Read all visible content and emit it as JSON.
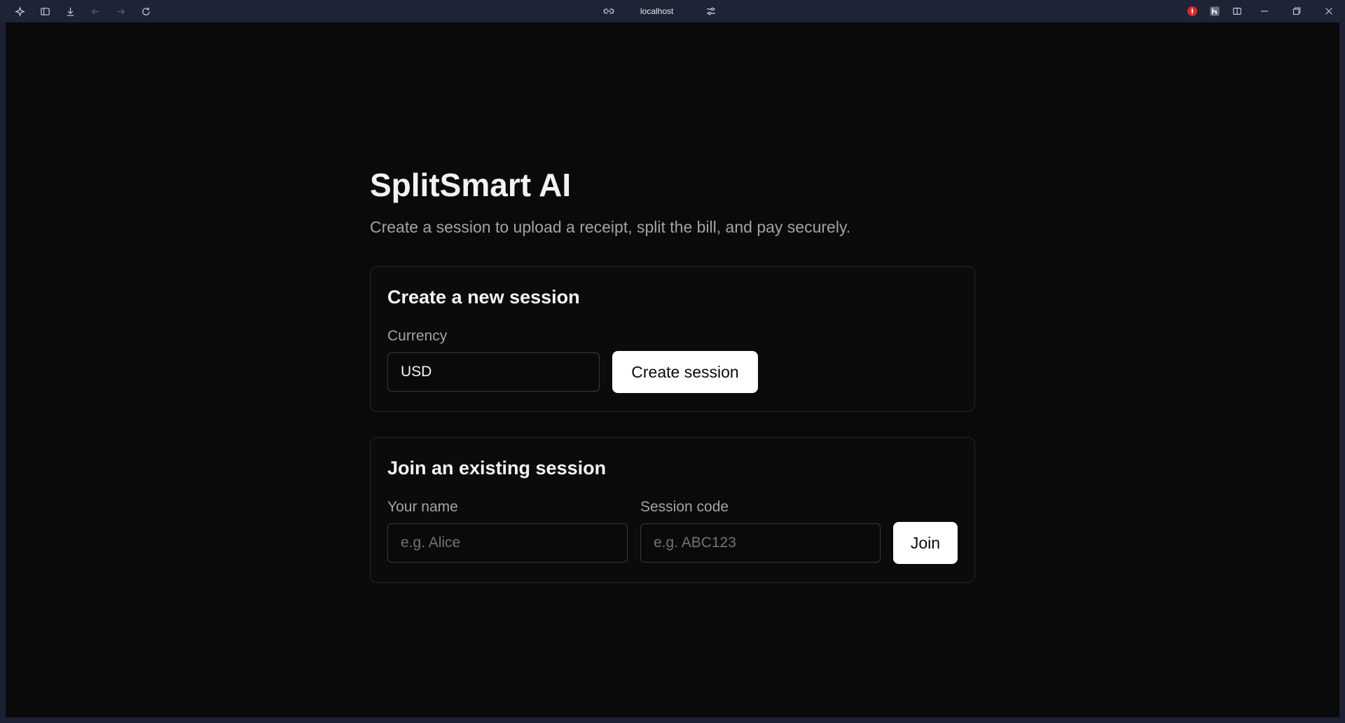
{
  "browser": {
    "url": "localhost",
    "icons": {
      "app": "spark-icon",
      "sidebar": "sidebar-toggle-icon",
      "download": "download-icon",
      "back": "back-arrow-icon",
      "forward": "forward-arrow-icon",
      "reload": "reload-icon",
      "link": "link-icon",
      "tune": "tune-icon"
    },
    "extension_colors": {
      "red_badge": "#e0262b",
      "tile": "#6b7280"
    }
  },
  "page": {
    "title": "SplitSmart AI",
    "subtitle": "Create a session to upload a receipt, split the bill, and pay securely."
  },
  "create_session": {
    "heading": "Create a new session",
    "currency_label": "Currency",
    "currency_value": "USD",
    "button_label": "Create session"
  },
  "join_session": {
    "heading": "Join an existing session",
    "name_label": "Your name",
    "name_placeholder": "e.g. Alice",
    "code_label": "Session code",
    "code_placeholder": "e.g. ABC123",
    "button_label": "Join"
  },
  "theme": {
    "background": "#0a0a0b",
    "card_border": "#27272a",
    "button_bg": "#ffffff",
    "text_primary": "#f2f2f2",
    "text_muted": "#a3a3a3"
  }
}
